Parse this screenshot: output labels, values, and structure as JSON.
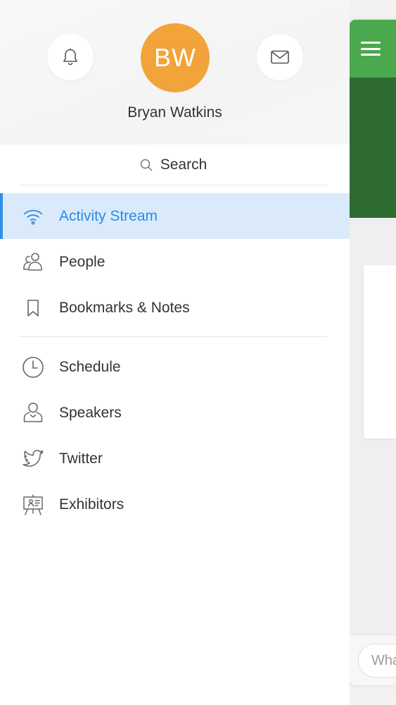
{
  "profile": {
    "initials": "BW",
    "name": "Bryan Watkins",
    "avatar_color": "#f2a43a",
    "notifications_icon": "bell-icon",
    "messages_icon": "mail-icon"
  },
  "search": {
    "label": "Search",
    "icon": "search-icon"
  },
  "nav": {
    "primary": [
      {
        "label": "Activity Stream",
        "icon": "wifi-icon",
        "active": true
      },
      {
        "label": "People",
        "icon": "people-icon"
      },
      {
        "label": "Bookmarks & Notes",
        "icon": "bookmark-icon"
      }
    ],
    "secondary": [
      {
        "label": "Schedule",
        "icon": "clock-icon"
      },
      {
        "label": "Speakers",
        "icon": "speaker-icon"
      },
      {
        "label": "Twitter",
        "icon": "twitter-icon"
      },
      {
        "label": "Exhibitors",
        "icon": "exhibitor-icon"
      }
    ]
  },
  "background_app": {
    "composer_placeholder": "What",
    "topbar_color": "#4aa94d",
    "banner_color": "#2e6b31"
  },
  "colors": {
    "active_bg": "#dbeafb",
    "active_accent": "#2f8fe6"
  }
}
